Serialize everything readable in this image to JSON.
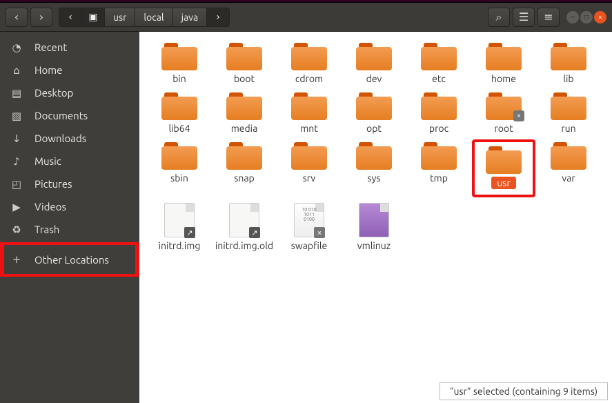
{
  "breadcrumb": {
    "segments": [
      "usr",
      "local",
      "java"
    ]
  },
  "sidebar": {
    "items": [
      {
        "icon": "clock-icon",
        "label": "Recent"
      },
      {
        "icon": "home-icon",
        "label": "Home"
      },
      {
        "icon": "desktop-icon",
        "label": "Desktop"
      },
      {
        "icon": "documents-icon",
        "label": "Documents"
      },
      {
        "icon": "downloads-icon",
        "label": "Downloads"
      },
      {
        "icon": "music-icon",
        "label": "Music"
      },
      {
        "icon": "pictures-icon",
        "label": "Pictures"
      },
      {
        "icon": "videos-icon",
        "label": "Videos"
      },
      {
        "icon": "trash-icon",
        "label": "Trash"
      },
      {
        "icon": "plus-icon",
        "label": "Other Locations",
        "highlight": true
      }
    ]
  },
  "files": [
    {
      "type": "folder",
      "name": "bin"
    },
    {
      "type": "folder",
      "name": "boot"
    },
    {
      "type": "folder",
      "name": "cdrom"
    },
    {
      "type": "folder",
      "name": "dev"
    },
    {
      "type": "folder",
      "name": "etc"
    },
    {
      "type": "folder",
      "name": "home"
    },
    {
      "type": "folder",
      "name": "lib"
    },
    {
      "type": "folder",
      "name": "lib64"
    },
    {
      "type": "folder",
      "name": "media"
    },
    {
      "type": "folder",
      "name": "mnt"
    },
    {
      "type": "folder",
      "name": "opt"
    },
    {
      "type": "folder",
      "name": "proc"
    },
    {
      "type": "folder",
      "name": "root",
      "locked": true
    },
    {
      "type": "folder",
      "name": "run"
    },
    {
      "type": "folder",
      "name": "sbin"
    },
    {
      "type": "folder",
      "name": "snap"
    },
    {
      "type": "folder",
      "name": "srv"
    },
    {
      "type": "folder",
      "name": "sys"
    },
    {
      "type": "folder",
      "name": "tmp"
    },
    {
      "type": "folder",
      "name": "usr",
      "selected": true
    },
    {
      "type": "folder",
      "name": "var"
    },
    {
      "type": "file",
      "name": "initrd.img",
      "variant": "link"
    },
    {
      "type": "file",
      "name": "initrd.img.old",
      "variant": "link"
    },
    {
      "type": "file",
      "name": "swapfile",
      "variant": "binlock"
    },
    {
      "type": "file",
      "name": "vmlinuz",
      "variant": "zip"
    }
  ],
  "status": "“usr” selected  (containing 9 items)",
  "icons": {
    "back": "‹",
    "forward": "›",
    "up": "←",
    "disk": "▣",
    "chev": "›",
    "search": "⌕",
    "grid": "☰",
    "menu": "≡",
    "min": "–",
    "max": "□",
    "close": "×",
    "clock-icon": "◔",
    "home-icon": "⌂",
    "desktop-icon": "▤",
    "documents-icon": "▧",
    "downloads-icon": "↓",
    "music-icon": "♪",
    "pictures-icon": "◰",
    "videos-icon": "▶",
    "trash-icon": "♻",
    "plus-icon": "+",
    "lock": "×"
  }
}
